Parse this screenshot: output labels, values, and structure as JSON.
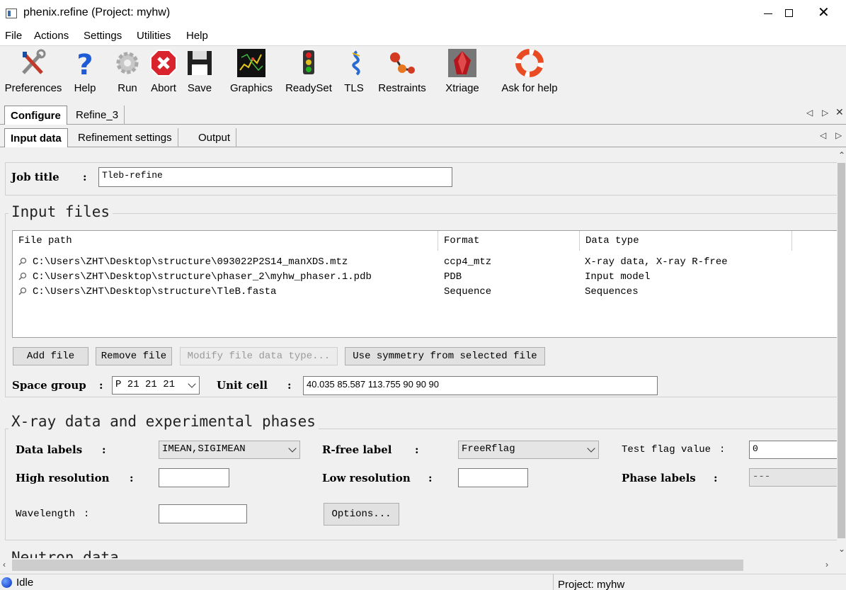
{
  "window": {
    "title": "phenix.refine (Project: myhw)"
  },
  "menu": [
    "File",
    "Actions",
    "Settings",
    "Utilities",
    "Help"
  ],
  "toolbar": {
    "preferences": "Preferences",
    "help": "Help",
    "run": "Run",
    "abort": "Abort",
    "save": "Save",
    "graphics": "Graphics",
    "readyset": "ReadySet",
    "tls": "TLS",
    "restraints": "Restraints",
    "xtriage": "Xtriage",
    "askhelp": "Ask for help"
  },
  "outer_tabs": {
    "configure": "Configure",
    "refine3": "Refine_3"
  },
  "inner_tabs": {
    "input": "Input data",
    "refinement": "Refinement settings",
    "output": "Output"
  },
  "job": {
    "label": "Job title",
    "colon": ":",
    "value": "Tleb-refine"
  },
  "input_files": {
    "title": "Input files",
    "headers": {
      "path": "File path",
      "format": "Format",
      "type": "Data type"
    },
    "rows": [
      {
        "path": "C:\\Users\\ZHT\\Desktop\\structure\\093022P2S14_manXDS.mtz",
        "format": "ccp4_mtz",
        "type": "X-ray data, X-ray R-free"
      },
      {
        "path": "C:\\Users\\ZHT\\Desktop\\structure\\phaser_2\\myhw_phaser.1.pdb",
        "format": "PDB",
        "type": "Input model"
      },
      {
        "path": "C:\\Users\\ZHT\\Desktop\\structure\\TleB.fasta",
        "format": "Sequence",
        "type": "Sequences"
      }
    ],
    "buttons": {
      "add": "Add file",
      "remove": "Remove file",
      "modify": "Modify file data type...",
      "symmetry": "Use symmetry from selected file"
    },
    "space_group_label": "Space group",
    "space_group": "P 21 21 21",
    "unit_cell_label": "Unit cell",
    "unit_cell": "40.035 85.587 113.755 90 90 90"
  },
  "xray": {
    "title": "X-ray data and experimental phases",
    "data_labels_label": "Data labels",
    "data_labels": "IMEAN,SIGIMEAN",
    "rfree_label": "R-free label",
    "rfree": "FreeRflag",
    "test_flag_label": "Test flag value",
    "test_flag": "0",
    "high_res_label": "High resolution",
    "high_res": "",
    "low_res_label": "Low resolution",
    "low_res": "",
    "phase_labels_label": "Phase labels",
    "phase_labels": "---",
    "wavelength_label": "Wavelength",
    "wavelength": "",
    "options_button": "Options..."
  },
  "neutron": {
    "title": "Neutron data"
  },
  "status": {
    "state": "Idle",
    "project": "Project: myhw"
  }
}
